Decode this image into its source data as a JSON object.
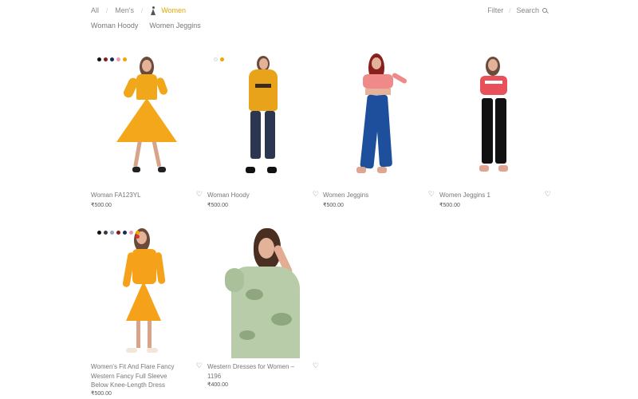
{
  "breadcrumb": {
    "items": [
      {
        "label": "All"
      },
      {
        "label": "Men's"
      },
      {
        "label": "Women"
      }
    ]
  },
  "toolbar": {
    "filter_label": "Filter",
    "search_label": "Search"
  },
  "subcategories": [
    "Woman Hoody",
    "Women Jeggins"
  ],
  "products": [
    {
      "name": "Woman FA123YL",
      "price": "₹500.00",
      "swatches": [
        "#111111",
        "#8b1a1a",
        "#1a2a5a",
        "#e89ab8",
        "#f0a500"
      ]
    },
    {
      "name": "Woman Hoody",
      "price": "₹500.00",
      "swatches": [
        "#f3f3f3",
        "#f0a500"
      ]
    },
    {
      "name": "Women Jeggins",
      "price": "₹500.00",
      "swatches": []
    },
    {
      "name": "Women Jeggins 1",
      "price": "₹500.00",
      "swatches": []
    },
    {
      "name": "Women's Fit And Flare Fancy Western Fancy Full Sleeve Below Knee-Length Dress",
      "price": "₹500.00",
      "swatches": [
        "#111111",
        "#3a3a3a",
        "#8fa5c8",
        "#8b1a1a",
        "#1a2a5a",
        "#e89ab8",
        "#f0a500"
      ]
    },
    {
      "name": "Western Dresses for Women – 1196",
      "price": "₹400.00",
      "swatches": []
    }
  ],
  "colors": {
    "accent": "#e0a800"
  }
}
